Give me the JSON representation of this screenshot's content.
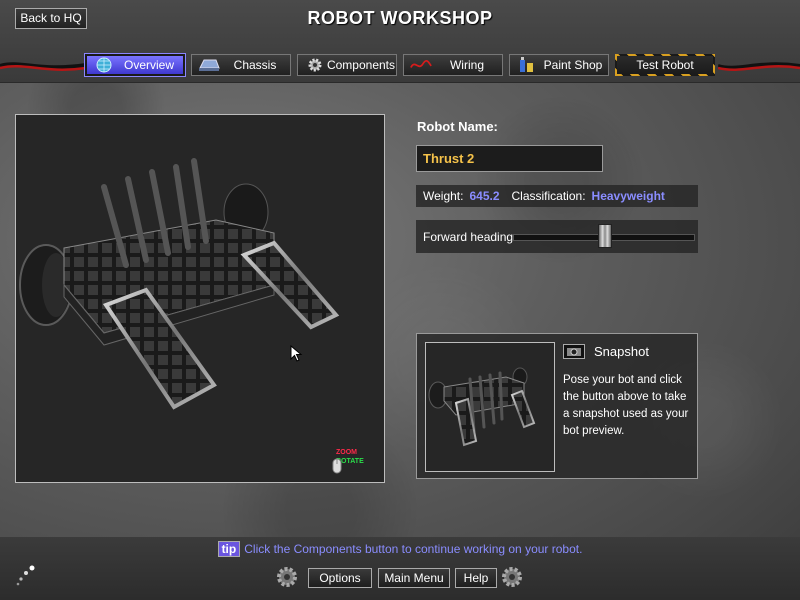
{
  "header": {
    "title": "ROBOT WORKSHOP",
    "back_label": "Back to HQ"
  },
  "tabs": [
    {
      "label": "Overview",
      "icon": "globe-icon",
      "active": true
    },
    {
      "label": "Chassis",
      "icon": "chassis-icon",
      "active": false
    },
    {
      "label": "Components",
      "icon": "gear-icon",
      "active": false
    },
    {
      "label": "Wiring",
      "icon": "wire-icon",
      "active": false
    },
    {
      "label": "Paint Shop",
      "icon": "paint-cans-icon",
      "active": false
    },
    {
      "label": "Test Robot",
      "icon": "",
      "active": false
    }
  ],
  "viewport": {
    "zoom_label": "ZOOM",
    "rotate_label": "ROTATE"
  },
  "robot": {
    "name_label": "Robot Name:",
    "name_value": "Thrust 2",
    "weight_label": "Weight:",
    "weight_value": "645.2",
    "class_label": "Classification:",
    "class_value": "Heavyweight",
    "heading_label": "Forward heading:",
    "heading_value": 0.47
  },
  "snapshot": {
    "title": "Snapshot",
    "description": "Pose your bot and click the button above to take a snapshot used as your bot preview."
  },
  "footer": {
    "tip_badge": "tip",
    "tip_text": "Click the Components button to continue working on your robot.",
    "options_label": "Options",
    "main_menu_label": "Main Menu",
    "help_label": "Help"
  },
  "colors": {
    "accent_blue": "#8a8dff",
    "name_gold": "#f5c24a",
    "active_tab": "#5a54f0",
    "hazard_yellow": "#d9a020"
  }
}
